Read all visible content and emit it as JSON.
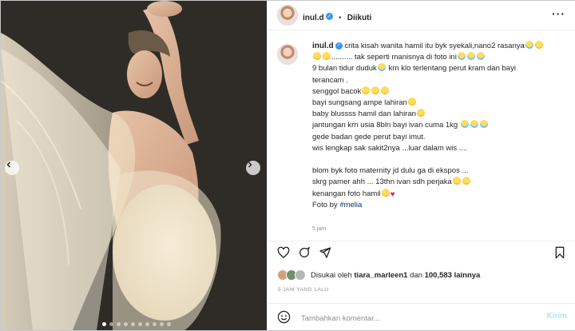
{
  "post": {
    "username": "inul.d",
    "follow_label": "Diikuti",
    "follow_separator": "•",
    "more_label": "···"
  },
  "caption": {
    "username": "inul.d",
    "lines": [
      "crita kisah wanita hamil itu byk syekali,nano2 rasanya",
      ".......... tak seperti manisnya di foto ini",
      "9 bulan tidur duduk",
      "krn klo terlentang perut kram dan bayi",
      "terancam .",
      "senggol bacok",
      "bayi sungsang ampe lahiran",
      "baby blussss hamil dan lahiran",
      "jantungan krn usia 8bln bayi ivan cuma 1kg",
      "gede badan gede perut bayi imut.",
      "wis lengkap sak sakit2nya ...luar dalam wis ....",
      "blom byk foto maternity jd dulu ga di ekspos ...",
      "skrg pamer ahh ... 13thn ivan sdh perjaka",
      "kenangan foto hamil",
      "Foto by",
      "#melia"
    ],
    "time_ago": "5 jam"
  },
  "likes": {
    "prefix": "Disukai oleh",
    "first_user": "tiara_marleen1",
    "joiner": "dan",
    "count_text": "100,583 lainnya"
  },
  "timestamp": "5 JAM YANG LALU",
  "comment": {
    "placeholder": "Tambahkan komentar...",
    "send_label": "Kirim"
  },
  "carousel": {
    "total_slides": 10,
    "active_index": 0
  },
  "colors": {
    "link": "#00376b",
    "verified": "#3897f0",
    "send_disabled": "#b2dffc",
    "secondary_text": "#8e8e8e"
  },
  "icons": [
    "chevron-left-icon",
    "chevron-right-icon",
    "heart-icon",
    "comment-icon",
    "share-icon",
    "bookmark-icon",
    "emoji-icon",
    "more-icon",
    "verified-icon"
  ]
}
